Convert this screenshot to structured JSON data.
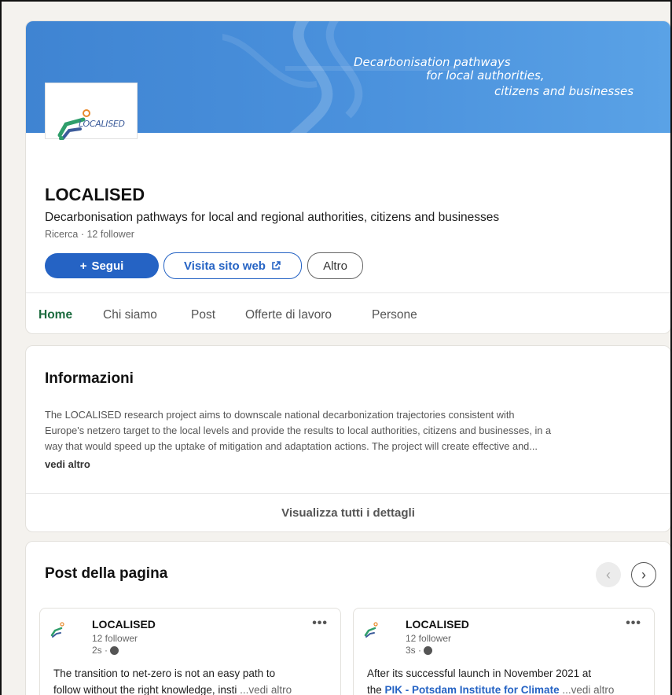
{
  "banner": {
    "line1": "Decarbonisation pathways",
    "line2": "for local authorities,",
    "line3": "citizens and businesses",
    "color": "#4a90dc"
  },
  "logo": {
    "text": "LOCALISED"
  },
  "company": {
    "name": "LOCALISED",
    "tagline": "Decarbonisation pathways for local and regional authorities, citizens and businesses",
    "meta": "Ricerca · 12 follower"
  },
  "actions": {
    "follow": "Segui",
    "follow_icon": "+",
    "website": "Visita sito web",
    "more": "Altro"
  },
  "tabs": [
    {
      "label": "Home",
      "active": true
    },
    {
      "label": "Chi siamo"
    },
    {
      "label": "Post"
    },
    {
      "label": "Offerte di lavoro"
    },
    {
      "label": "Persone"
    }
  ],
  "about": {
    "title": "Informazioni",
    "line1": "The LOCALISED research project aims to downscale national decarbonization trajectories consistent with",
    "line2": "Europe's netzero target to the local levels and provide the results to local authorities, citizens and businesses, in a",
    "line3": "way that would speed up the uptake of mitigation and adaptation actions. The project will create effective and...",
    "see_more": "vedi altro",
    "details_link": "Visualizza tutti i dettagli"
  },
  "posts": {
    "title": "Post della pagina",
    "items": [
      {
        "name": "LOCALISED",
        "followers": "12 follower",
        "time": "2s ·",
        "text_line1": "The transition to net-zero is not an easy path to",
        "text_line2": "follow without the right knowledge, insti",
        "more": "...vedi altro"
      },
      {
        "name": "LOCALISED",
        "followers": "12 follower",
        "time": "3s ·",
        "text_line1": "After its successful launch in November 2021 at",
        "text_line2_prefix": "the",
        "text_line2_link": "PIK - Potsdam Institute for Climate",
        "more": "...vedi altro"
      }
    ]
  }
}
